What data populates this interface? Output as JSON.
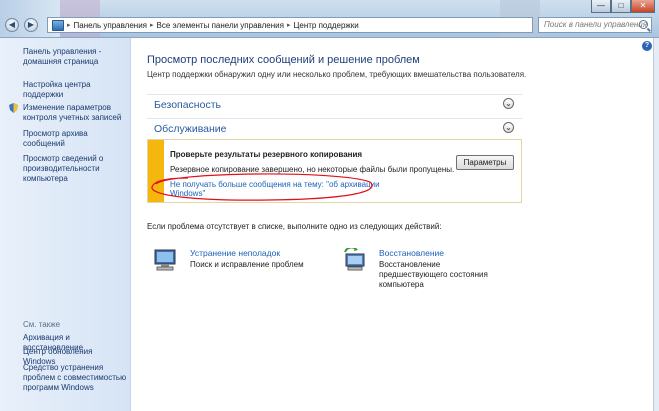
{
  "addressbar": {
    "segments": [
      "Панель управления",
      "Все элементы панели управления",
      "Центр поддержки"
    ],
    "search_placeholder": "Поиск в панели управления"
  },
  "sidebar": {
    "top_links": [
      {
        "label": "Панель управления - домашняя страница"
      },
      {
        "label": "Настройка центра поддержки"
      },
      {
        "label": "Изменение параметров контроля учетных записей"
      },
      {
        "label": "Просмотр архива сообщений"
      },
      {
        "label": "Просмотр сведений о производительности компьютера"
      }
    ],
    "see_also_label": "См. также",
    "see_also": [
      {
        "label": "Архивация и восстановление"
      },
      {
        "label": "Центр обновления Windows"
      },
      {
        "label": "Средство устранения проблем с совместимостью программ Windows"
      }
    ]
  },
  "main": {
    "title": "Просмотр последних сообщений и решение проблем",
    "subtitle": "Центр поддержки обнаружил одну или несколько проблем, требующих вмешательства пользователя.",
    "sections": [
      {
        "label": "Безопасность"
      },
      {
        "label": "Обслуживание"
      }
    ],
    "alert": {
      "title": "Проверьте результаты резервного копирования",
      "message": "Резервное копирование завершено, но некоторые файлы были пропущены.",
      "link": "Не получать больше сообщения на тему: \"об архивации Windows\"",
      "button": "Параметры"
    },
    "prompt": "Если проблема отсутствует в списке, выполните одно из следующих действий:",
    "actions": [
      {
        "title": "Устранение неполадок",
        "desc": "Поиск и исправление проблем"
      },
      {
        "title": "Восстановление",
        "desc": "Восстановление предшествующего состояния компьютера"
      }
    ]
  },
  "colors": {
    "accent": "#2a5a9f",
    "link": "#1b62b8",
    "warning": "#f5b60e",
    "annotation": "#e0101a"
  }
}
